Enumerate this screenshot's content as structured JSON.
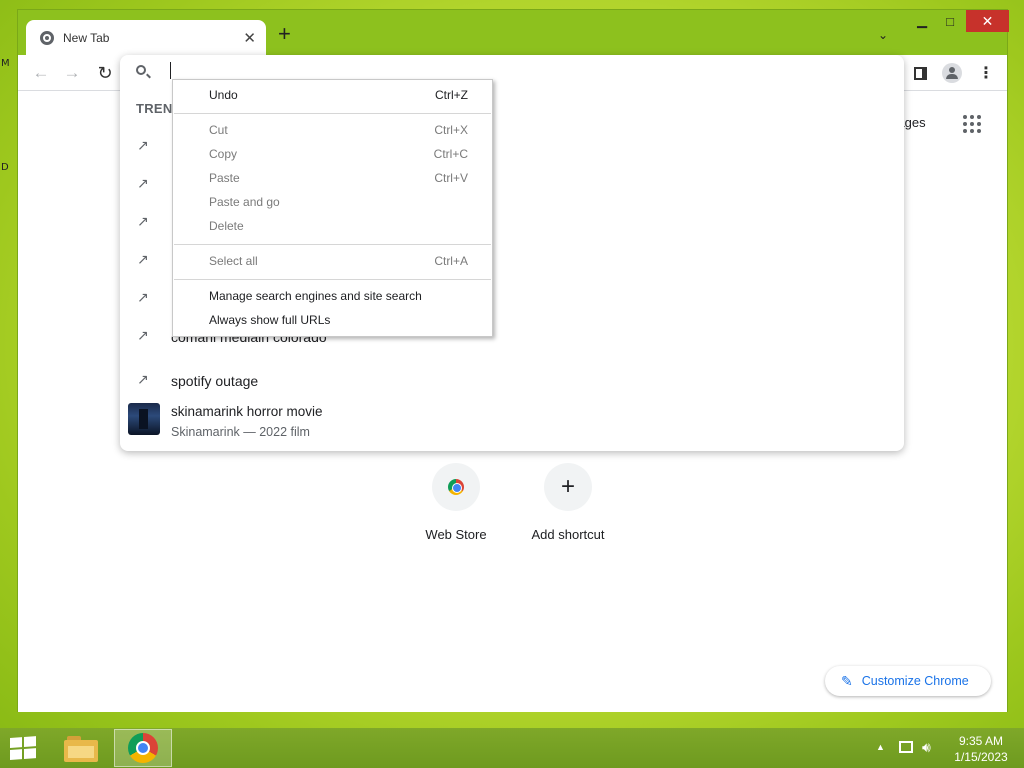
{
  "desktop": {
    "edge_glyphs": [
      "M",
      "D"
    ]
  },
  "browser": {
    "tab": {
      "title": "New Tab"
    },
    "window_controls": {
      "minimize": "▁",
      "maximize": "□",
      "close": "✕"
    },
    "content": {
      "images_link": "Images",
      "shortcuts": [
        {
          "label": "Web Store",
          "icon": "chrome-web-store-icon"
        },
        {
          "label": "Add shortcut",
          "icon": "plus-icon"
        }
      ],
      "customize_label": "Customize Chrome"
    },
    "omnibox": {
      "trending_heading": "TRENDING SEARCHES",
      "suggestions": [
        {
          "text": ""
        },
        {
          "text": ""
        },
        {
          "text": ""
        },
        {
          "text": ""
        },
        {
          "text": ""
        },
        {
          "text": "comanl medlaln colorado"
        },
        {
          "text": "spotify outage"
        }
      ],
      "rich_suggestion": {
        "title": "skinamarink horror movie",
        "subtitle": "Skinamarink — 2022 film"
      }
    },
    "context_menu": {
      "items": [
        {
          "label": "Undo",
          "shortcut": "Ctrl+Z",
          "enabled": true
        },
        {
          "label": "Cut",
          "shortcut": "Ctrl+X",
          "enabled": false
        },
        {
          "label": "Copy",
          "shortcut": "Ctrl+C",
          "enabled": false
        },
        {
          "label": "Paste",
          "shortcut": "Ctrl+V",
          "enabled": false
        },
        {
          "label": "Paste and go",
          "shortcut": "",
          "enabled": false
        },
        {
          "label": "Delete",
          "shortcut": "",
          "enabled": false
        },
        {
          "label": "Select all",
          "shortcut": "Ctrl+A",
          "enabled": false
        },
        {
          "label": "Manage search engines and site search",
          "shortcut": "",
          "enabled": true
        },
        {
          "label": "Always show full URLs",
          "shortcut": "",
          "enabled": true
        }
      ]
    }
  },
  "taskbar": {
    "pinned": [
      "file-explorer-icon",
      "chrome-icon"
    ],
    "clock": {
      "time": "9:35 AM",
      "date": "1/15/2023"
    }
  },
  "colors": {
    "accent": "#1a73e8",
    "close_button": "#c7322b",
    "desktop": "#b6d92c"
  }
}
